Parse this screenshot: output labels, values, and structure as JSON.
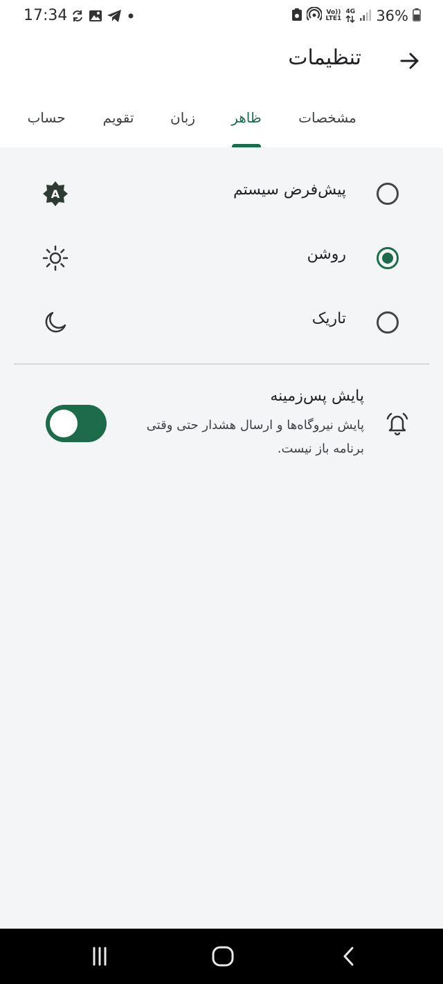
{
  "status_bar": {
    "time": "17:34",
    "battery_percent": "36%",
    "volte_top": "Vo))",
    "volte_bottom": "LTE1",
    "network_type": "4G",
    "icons": [
      "sync-icon",
      "gallery-icon",
      "telegram-icon",
      "dot-icon",
      "lock-file-icon",
      "hotspot-icon",
      "volte-icon",
      "data-arrows-icon",
      "signal-icon",
      "battery-icon"
    ]
  },
  "app_bar": {
    "title": "تنظیمات",
    "back_icon": "arrow-right-icon"
  },
  "tabs": [
    {
      "label": "مشخصات",
      "active": false
    },
    {
      "label": "ظاهر",
      "active": true
    },
    {
      "label": "زبان",
      "active": false
    },
    {
      "label": "تقویم",
      "active": false
    },
    {
      "label": "حساب",
      "active": false
    }
  ],
  "theme_options": [
    {
      "label": "پیش‌فرض سیستم",
      "selected": false,
      "icon": "auto-brightness-icon"
    },
    {
      "label": "روشن",
      "selected": true,
      "icon": "sun-icon"
    },
    {
      "label": "تاریک",
      "selected": false,
      "icon": "moon-icon"
    }
  ],
  "background_monitoring": {
    "title": "پایش پس‌زمینه",
    "description": "پایش نیروگاه‌ها و ارسال هشدار حتی وقتی برنامه باز نیست.",
    "enabled": true,
    "icon": "alarm-bell-icon"
  },
  "colors": {
    "accent": "#1e6b4b",
    "background": "#f3f5f7",
    "surface": "#ffffff",
    "nav_bar": "#000000"
  },
  "nav_bar": {
    "buttons": [
      "recents-icon",
      "home-icon",
      "back-chevron-icon"
    ]
  }
}
